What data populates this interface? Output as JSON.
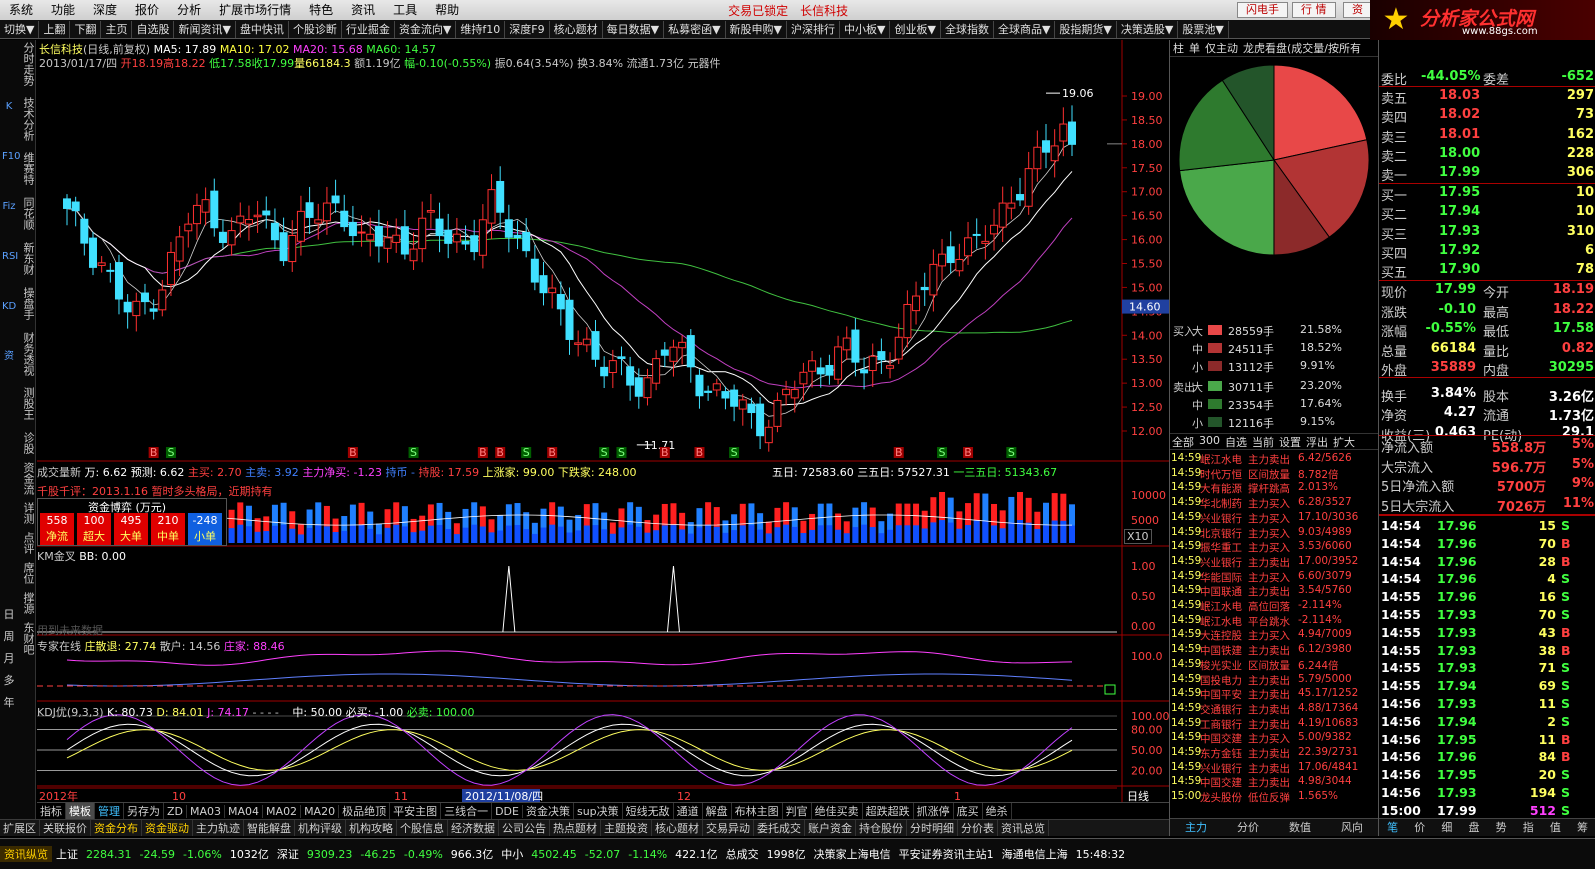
{
  "menu": {
    "items": [
      "系统",
      "功能",
      "深度",
      "报价",
      "分析",
      "扩展市场行情",
      "特色",
      "资讯",
      "工具",
      "帮助"
    ],
    "status1": "交易已锁定",
    "status2": "长信科技",
    "right_buttons": [
      "闪电手",
      "行 情",
      "资"
    ]
  },
  "logo": {
    "title": "分析家公式网",
    "url": "www.88gs.com"
  },
  "toolbar": [
    "切换▼",
    "上翻",
    "下翻",
    "主页",
    "自选股",
    "新闻资讯▼",
    "盘中快讯",
    "个股诊断",
    "行业掘金",
    "资金流向▼",
    "维持f10",
    "深度F9",
    "核心题材",
    "每日数据▼",
    "私募密函▼",
    "新股申购▼",
    "沪深排行",
    "中小板▼",
    "创业板▼",
    "全球指数",
    "全球商品▼",
    "股指期货▼",
    "决策选股▼",
    "股票池▼"
  ],
  "left_tabs": {
    "vertical": [
      "分时走势",
      "技术分析",
      "维赛特",
      "同花顺",
      "新东财",
      "操盘手",
      "财务透视",
      "测股王",
      "诊股",
      "资金流",
      "详测",
      "点评",
      "席位",
      "撑源",
      "东财吧"
    ],
    "periods": [
      "日",
      "周",
      "月",
      "多",
      "年"
    ],
    "icons": [
      "K",
      "F10",
      "Fiz",
      "RSI",
      "KD",
      "资"
    ]
  },
  "chart": {
    "main": {
      "title": "长信科技",
      "mode": "(日线,前复权)",
      "ma5": "MA5: 17.89",
      "ma10": "MA10: 17.02",
      "ma20": "MA20: 15.68",
      "ma60": "MA60: 14.57",
      "info_date": "2013/01/17/四",
      "info_open": "开18.19",
      "info_high": "高18.22",
      "info_low": "低17.58",
      "info_close": "收17.99",
      "info_vol": "量66184.3",
      "info_amt": "额1.19亿",
      "info_chg": "幅-0.10(-0.55%)",
      "info_amp": "振0.64(3.54%)",
      "info_turn": "换3.84%",
      "info_float": "流通1.73亿",
      "info_ind": "元器件",
      "price_high_label": "19.06",
      "price_low_label": "11.71",
      "current_price": "14.60",
      "y_ticks": [
        "19.00",
        "18.50",
        "18.00",
        "17.50",
        "17.00",
        "16.50",
        "16.00",
        "15.50",
        "15.00",
        "14.50",
        "14.00",
        "13.50",
        "13.00",
        "12.50",
        "12.00"
      ]
    },
    "vol": {
      "l1": "成交量新",
      "l2": "万: 6.62",
      "l3": "预测: 6.62",
      "l4": "主买: 2.70",
      "l5": "主卖: 3.92",
      "l6": "主力净买: -1.23",
      "l7": "持币 -",
      "l8": "持股: 17.59",
      "l9": "上涨家: 99.00",
      "l10": "下跌家: 248.00",
      "r1": "五日: 72583.60",
      "r2": "三五日: 57527.31",
      "r3": "一三五日: 51343.67",
      "y_ticks": [
        "10000",
        "5000"
      ],
      "x10": "X10",
      "comment": "千股千评：2013.1.16 暂时多头格局，近期持有",
      "fund_title": "资金博弈 (万元)",
      "fund_values": [
        "558",
        "100",
        "495",
        "210",
        "-248"
      ],
      "fund_labels": [
        "净流",
        "超大",
        "大单",
        "中单",
        "小单"
      ]
    },
    "km": {
      "title": "KM金叉",
      "bb": "BB: 0.00",
      "nodata": "用到未来数据",
      "y_ticks": [
        "1.00",
        "0.50",
        "0.00"
      ]
    },
    "expert": {
      "title": "专家在线",
      "v1": "庄散退: 27.74",
      "v2": "散户: 14.56",
      "v3": "庄家: 88.46",
      "y_tick": "100.0"
    },
    "kdj": {
      "title": "KDJ优(9,3,3)",
      "k": "K: 80.73",
      "d": "D: 84.01",
      "j": "J: 74.17",
      "dots": "- - - -",
      "mid": "中: 50.00",
      "buy": "必买: -1.00",
      "must": "必卖: 100.00",
      "y_ticks": [
        "100.00",
        "80.00",
        "50.00",
        "20.00"
      ]
    },
    "x_axis": {
      "year": "2012年",
      "m10": "10",
      "m11": "11",
      "cursor": "2012/11/08/四",
      "m12": "12",
      "m1": "1",
      "right": "日线"
    }
  },
  "bottom_tabs1": [
    "指标",
    "模板",
    "管理",
    "另存为",
    "ZD",
    "MA03",
    "MA04",
    "MA02",
    "MA20",
    "极品绝顶",
    "平安主图",
    "三线合一",
    "DDE",
    "资金决策",
    "sup决策",
    "短线无敌",
    "通道",
    "解盘",
    "布林主图",
    "判官",
    "绝佳买卖",
    "超跌超跌",
    "抓涨停",
    "底买",
    "绝杀"
  ],
  "bottom_tabs2": [
    "扩展区",
    "关联报价",
    "资金分布",
    "资金驱动",
    "主力轨迹",
    "智能解盘",
    "机构评级",
    "机构攻略",
    "个股信息",
    "经济数据",
    "公司公告",
    "热点题材",
    "主题投资",
    "核心题材",
    "交易异动",
    "委托成交",
    "账户资金",
    "持仓股份",
    "分时明细",
    "分价表",
    "资讯总览"
  ],
  "statusbar": {
    "feed": "资讯纵览",
    "sh": "上证",
    "sh_val": "2284.31",
    "sh_chg": "-24.59",
    "sh_pct": "-1.06%",
    "sh_amt": "1032亿",
    "sz": "深证",
    "sz_val": "9309.23",
    "sz_chg": "-46.25",
    "sz_pct": "-0.49%",
    "sz_amt": "966.3亿",
    "zx": "中小",
    "zx_val": "4502.45",
    "zx_chg": "-52.07",
    "zx_pct": "-1.14%",
    "zx_amt": "422.1亿",
    "total": "总成交",
    "total_val": "1998亿",
    "msg1": "决策家上海电信",
    "msg2": "平安证券资讯主站1",
    "msg3": "海通电信上海",
    "time": "15:48:32"
  },
  "mid": {
    "header": [
      "柱",
      "单",
      "仅主动",
      "龙虎看盘(成交量/按所有"
    ],
    "pie": {
      "colors": [
        "#e84848",
        "#b23434",
        "#8c2a2a",
        "#4aa84a",
        "#2e7a2e",
        "#23552a"
      ],
      "values": [
        21.58,
        18.52,
        9.91,
        23.2,
        17.64,
        9.15
      ]
    },
    "flow": [
      {
        "side": "买入",
        "lvl": "大",
        "vol": "28559手",
        "pct": "21.58%",
        "color": "#e84848"
      },
      {
        "side": "",
        "lvl": "中",
        "vol": "24511手",
        "pct": "18.52%",
        "color": "#b23434"
      },
      {
        "side": "",
        "lvl": "小",
        "vol": "13112手",
        "pct": "9.91%",
        "color": "#8c2a2a"
      },
      {
        "side": "卖出",
        "lvl": "大",
        "vol": "30711手",
        "pct": "23.20%",
        "color": "#4aa84a"
      },
      {
        "side": "",
        "lvl": "中",
        "vol": "23354手",
        "pct": "17.64%",
        "color": "#2e7a2e"
      },
      {
        "side": "",
        "lvl": "小",
        "vol": "12116手",
        "pct": "9.15%",
        "color": "#23552a"
      }
    ],
    "news_tabs": [
      "全部",
      "300",
      "自选",
      "当前",
      "设置",
      "浮出",
      "扩大"
    ],
    "news": [
      [
        "14:59",
        "岷江水电",
        "主力卖出",
        "6.42/5626"
      ],
      [
        "14:59",
        "时代万恒",
        "区间放量",
        "8.782倍"
      ],
      [
        "14:59",
        "大有能源",
        "撑杆跳高",
        "2.013%"
      ],
      [
        "14:59",
        "华北制药",
        "主力买入",
        "6.28/3527"
      ],
      [
        "14:59",
        "兴业银行",
        "主力买入",
        "17.10/3036"
      ],
      [
        "14:59",
        "北京银行",
        "主力买入",
        "9.03/4989"
      ],
      [
        "14:59",
        "振华重工",
        "主力买入",
        "3.53/6060"
      ],
      [
        "14:59",
        "兴业银行",
        "主力卖出",
        "17.00/3952"
      ],
      [
        "14:59",
        "华能国际",
        "主力买入",
        "6.60/3079"
      ],
      [
        "14:59",
        "中国联通",
        "主力卖出",
        "3.54/5760"
      ],
      [
        "14:59",
        "岷江水电",
        "高位回落",
        "-2.114%"
      ],
      [
        "14:59",
        "岷江水电",
        "平台跳水",
        "-2.114%"
      ],
      [
        "14:59",
        "大连控股",
        "主力买入",
        "4.94/7009"
      ],
      [
        "14:59",
        "中国铁建",
        "主力卖出",
        "6.12/3980"
      ],
      [
        "14:59",
        "梭光实业",
        "区间放量",
        "6.244倍"
      ],
      [
        "14:59",
        "国投电力",
        "主力卖出",
        "5.79/5000"
      ],
      [
        "14:59",
        "中国平安",
        "主力卖出",
        "45.17/1252"
      ],
      [
        "14:59",
        "交通银行",
        "主力卖出",
        "4.88/17364"
      ],
      [
        "14:59",
        "工商银行",
        "主力卖出",
        "4.19/10683"
      ],
      [
        "14:59",
        "中国交建",
        "主力买入",
        "5.00/9382"
      ],
      [
        "14:59",
        "东方金钰",
        "主力卖出",
        "22.39/2731"
      ],
      [
        "14:59",
        "兴业银行",
        "主力卖出",
        "17.06/4841"
      ],
      [
        "14:59",
        "中国交建",
        "主力卖出",
        "4.98/3044"
      ],
      [
        "15:00",
        "龙头股份",
        "低位反弹",
        "1.565%"
      ]
    ],
    "bottom_tabs": [
      "主力",
      "分价",
      "数值",
      "风向"
    ]
  },
  "quote": {
    "top_rows": [
      {
        "l": "委比",
        "v": "-44.05%",
        "l2": "委差",
        "v2": "-652"
      }
    ],
    "asks": [
      {
        "l": "卖五",
        "p": "18.03",
        "q": "297"
      },
      {
        "l": "卖四",
        "p": "18.02",
        "q": "73"
      },
      {
        "l": "卖三",
        "p": "18.01",
        "q": "162"
      },
      {
        "l": "卖二",
        "p": "18.00",
        "q": "228"
      },
      {
        "l": "卖一",
        "p": "17.99",
        "q": "306"
      }
    ],
    "bids": [
      {
        "l": "买一",
        "p": "17.95",
        "q": "10"
      },
      {
        "l": "买二",
        "p": "17.94",
        "q": "10"
      },
      {
        "l": "买三",
        "p": "17.93",
        "q": "310"
      },
      {
        "l": "买四",
        "p": "17.92",
        "q": "6"
      },
      {
        "l": "买五",
        "p": "17.90",
        "q": "78"
      }
    ],
    "stats": [
      [
        "现价",
        "17.99",
        "今开",
        "18.19"
      ],
      [
        "涨跌",
        "-0.10",
        "最高",
        "18.22"
      ],
      [
        "涨幅",
        "-0.55%",
        "最低",
        "17.58"
      ],
      [
        "总量",
        "66184",
        "量比",
        "0.82"
      ],
      [
        "外盘",
        "35889",
        "内盘",
        "30295"
      ],
      [
        "换手",
        "3.84%",
        "股本",
        "3.26亿"
      ],
      [
        "净资",
        "4.27",
        "流通",
        "1.73亿"
      ],
      [
        "收益(三)",
        "0.463",
        "PE(动)",
        "29.1"
      ]
    ],
    "flows": [
      [
        "净流入额",
        "558.8万",
        "5%"
      ],
      [
        "大宗流入",
        "596.7万",
        "5%"
      ],
      [
        "5日净流入额",
        "5700万",
        "9%"
      ],
      [
        "5日大宗流入",
        "7026万",
        "11%"
      ]
    ],
    "ticks": [
      [
        "14:54",
        "17.96",
        "15",
        "S"
      ],
      [
        "14:54",
        "17.96",
        "70",
        "B"
      ],
      [
        "14:54",
        "17.96",
        "28",
        "B"
      ],
      [
        "14:54",
        "17.96",
        "4",
        "S"
      ],
      [
        "14:55",
        "17.96",
        "16",
        "S"
      ],
      [
        "14:55",
        "17.93",
        "70",
        "S"
      ],
      [
        "14:55",
        "17.93",
        "43",
        "B"
      ],
      [
        "14:55",
        "17.93",
        "38",
        "B"
      ],
      [
        "14:55",
        "17.93",
        "71",
        "S"
      ],
      [
        "14:55",
        "17.94",
        "69",
        "S"
      ],
      [
        "14:56",
        "17.93",
        "11",
        "S"
      ],
      [
        "14:56",
        "17.94",
        "2",
        "S"
      ],
      [
        "14:56",
        "17.95",
        "11",
        "B"
      ],
      [
        "14:56",
        "17.96",
        "84",
        "B"
      ],
      [
        "14:56",
        "17.95",
        "20",
        "S"
      ],
      [
        "14:56",
        "17.93",
        "194",
        "S"
      ],
      [
        "15:00",
        "17.99",
        "512",
        "S"
      ]
    ],
    "bottom_tabs": [
      "笔",
      "价",
      "细",
      "盘",
      "势",
      "指",
      "值",
      "筹"
    ]
  }
}
